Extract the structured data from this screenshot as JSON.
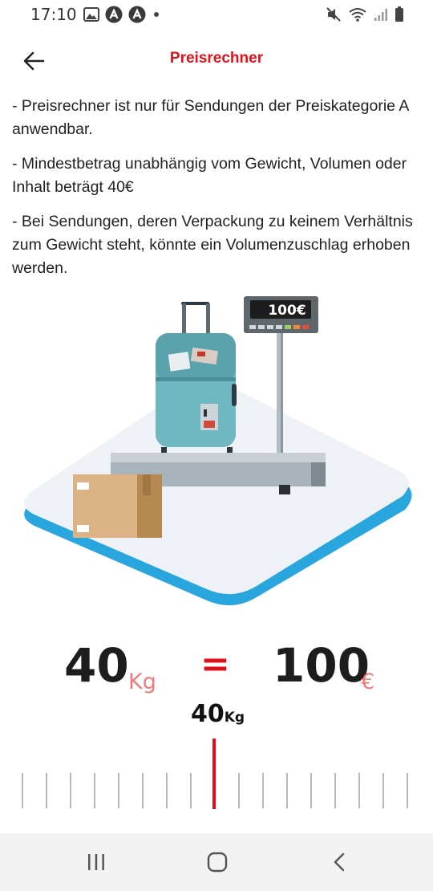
{
  "status_bar": {
    "time": "17:10",
    "icons_left": [
      "image-icon",
      "a-badge-icon",
      "a-badge-icon",
      "dot-icon"
    ],
    "icons_right": [
      "mute-icon",
      "wifi-icon",
      "signal-icon",
      "battery-icon"
    ]
  },
  "app_bar": {
    "title": "Preisrechner",
    "title_color": "#e3101a",
    "back_icon": "arrow-left-icon"
  },
  "info": {
    "lines": [
      "- Preisrechner ist nur für Sendungen der Preiskategorie A anwendbar.",
      "- Mindestbetrag unabhängig vom Gewicht, Volumen oder Inhalt beträgt 40€",
      "- Bei Sendungen, deren Verpackung zu keinem Verhältnis zum Gewicht steht, könnte ein Volumenzuschlag erhoben werden."
    ]
  },
  "illustration": {
    "scale_display": "100€"
  },
  "calculator": {
    "weight_value": "40",
    "weight_unit": "Kg",
    "equals": "=",
    "price_value": "100",
    "price_unit": "€",
    "accent_color": "#e3101a"
  },
  "weight_picker": {
    "value": "40",
    "unit": "Kg"
  },
  "nav_bar": {
    "buttons": [
      "recent-apps-icon",
      "home-icon",
      "back-chevron-icon"
    ]
  }
}
